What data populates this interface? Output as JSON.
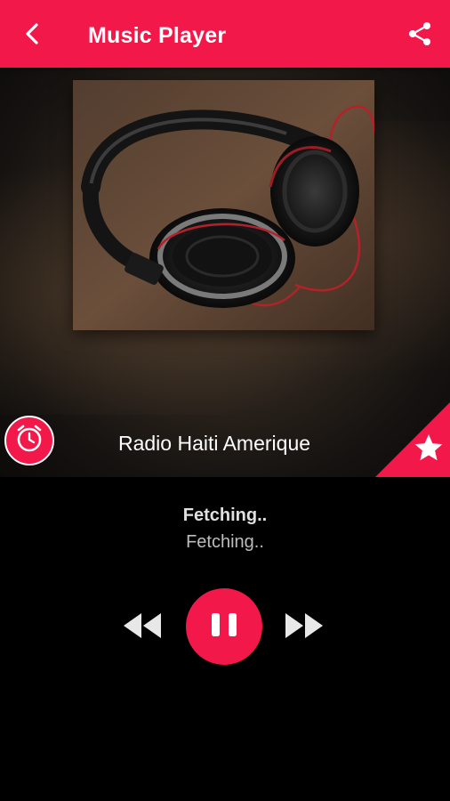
{
  "header": {
    "title": "Music Player",
    "back_icon": "arrow-back-icon",
    "share_icon": "share-icon"
  },
  "hero": {
    "station_name": "Radio Haiti Amerique",
    "artwork": "headphones-image",
    "alarm_icon": "alarm-clock-icon",
    "favorite_icon": "star-icon"
  },
  "now_playing": {
    "title": "Fetching..",
    "subtitle": "Fetching.."
  },
  "controls": {
    "rewind_icon": "fast-rewind-icon",
    "pause_icon": "pause-icon",
    "forward_icon": "fast-forward-icon"
  },
  "colors": {
    "accent": "#f2184a",
    "background": "#000000",
    "text_primary": "#ffffff",
    "text_secondary": "#bdbdbd"
  }
}
